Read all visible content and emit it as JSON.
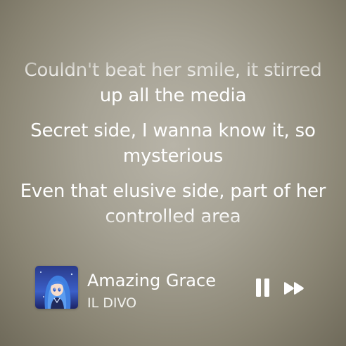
{
  "lyrics": {
    "line1": "Couldn't beat her smile, it stirred up all the media",
    "line2": "Secret side, I wanna know it, so mysterious",
    "line3": "Even that elusive side, part of her controlled area"
  },
  "now_playing": {
    "title": "Amazing Grace",
    "artist": "IL DIVO",
    "artwork_icon": "anime-girl-album-art",
    "state": "playing"
  },
  "controls": {
    "pause_icon": "pause-icon",
    "next_icon": "fast-forward-icon"
  },
  "colors": {
    "text": "#ffffff",
    "background": "#a5a193"
  }
}
